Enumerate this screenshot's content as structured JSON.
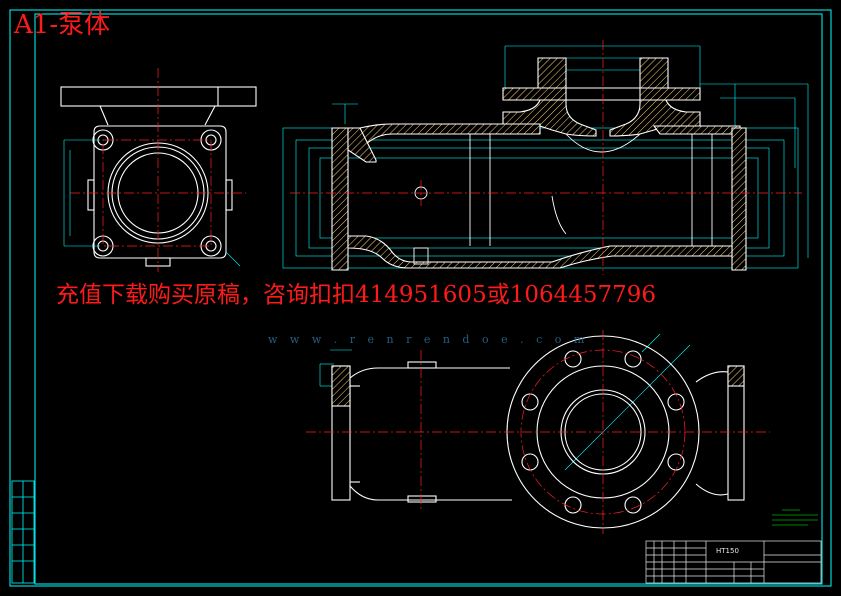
{
  "drawing": {
    "title": "A1-泵体",
    "ad_text": "充值下载购买原稿，咨询扣扣414951605或1064457796",
    "watermark_url": "w w w . r e n r e n d o e . c o m",
    "material": "HT150"
  },
  "colors": {
    "background": "#000000",
    "frame": "#00ffff",
    "geometry": "#ffffff",
    "centerline": "#ff2020",
    "hatch": "#ffd27a",
    "dimension": "#00ffff",
    "notes": "#00ff00",
    "title_text": "#ff1a1a"
  }
}
